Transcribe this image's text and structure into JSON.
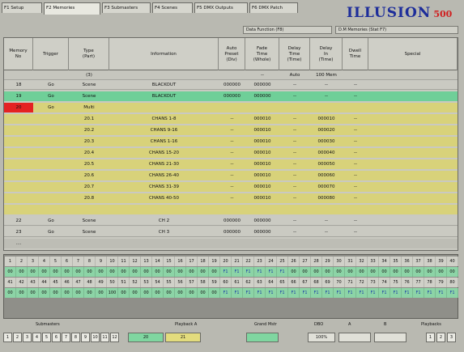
{
  "tabs": [
    "F1 Setup",
    "F2 Memories",
    "F3 Submasters",
    "F4 Scenes",
    "F5 DMX Outputs",
    "F6 DMX Patch"
  ],
  "active_tab": 1,
  "logo": {
    "text": "ILLUSION",
    "number": "500"
  },
  "top_fields": [
    "Data Function (F8)",
    "D.M Memories (Stat F7)"
  ],
  "colors": {
    "green_row": "#6fcf98",
    "yellow_block": "#d8d27a",
    "red_cell": "#e42222",
    "logo_blue": "#1d2d9a",
    "logo_red": "#d02020"
  },
  "columns": [
    "Memory\nNo",
    "Trigger",
    "Type\n(Part)",
    "Information",
    "Auto\nPreset\n(Div)",
    "Fade\nTime\n(Whole)",
    "Delay\nTime\n(Time)",
    "Delay\nIn\n(Time)",
    "Dwell\nTime",
    "Special"
  ],
  "sub_header": [
    "",
    "",
    "(3)",
    "",
    "",
    "--",
    "Auto",
    "100 Mem",
    "",
    ""
  ],
  "rows": [
    {
      "style": "plain",
      "cells": [
        "18",
        "Go",
        "Scene",
        "BLACKOUT",
        "000000",
        "000000",
        "--",
        "--",
        "--",
        ""
      ]
    },
    {
      "style": "green",
      "cells": [
        "19",
        "Go",
        "Scene",
        "BLACKOUT",
        "000000",
        "000000",
        "--",
        "--",
        "--",
        ""
      ]
    },
    {
      "style": "yellow",
      "red_first": true,
      "cells": [
        "20",
        "Go",
        "Multi",
        "",
        "",
        "",
        "",
        "",
        "",
        ""
      ]
    },
    {
      "style": "yellow",
      "cells": [
        "",
        "",
        "20.1",
        "CHANS 1-8",
        "--",
        "000010",
        "--",
        "000010",
        "--",
        ""
      ]
    },
    {
      "style": "yellow",
      "cells": [
        "",
        "",
        "20.2",
        "CHANS 9-16",
        "--",
        "000010",
        "--",
        "000020",
        "--",
        ""
      ]
    },
    {
      "style": "yellow",
      "cells": [
        "",
        "",
        "20.3",
        "CHANS 1-16",
        "--",
        "000010",
        "--",
        "000030",
        "--",
        ""
      ]
    },
    {
      "style": "yellow",
      "cells": [
        "",
        "",
        "20.4",
        "CHANS 15-20",
        "--",
        "000010",
        "--",
        "000040",
        "--",
        ""
      ]
    },
    {
      "style": "yellow",
      "cells": [
        "",
        "",
        "20.5",
        "CHANS 21-30",
        "--",
        "000010",
        "--",
        "000050",
        "--",
        ""
      ]
    },
    {
      "style": "yellow",
      "cells": [
        "",
        "",
        "20.6",
        "CHANS 26-40",
        "--",
        "000010",
        "--",
        "000060",
        "--",
        ""
      ]
    },
    {
      "style": "yellow",
      "cells": [
        "",
        "",
        "20.7",
        "CHANS 31-39",
        "--",
        "000010",
        "--",
        "000070",
        "--",
        ""
      ]
    },
    {
      "style": "yellow",
      "cells": [
        "",
        "",
        "20.8",
        "CHANS 40-50",
        "--",
        "000010",
        "--",
        "000080",
        "--",
        ""
      ]
    },
    {
      "style": "yellow",
      "cells": [
        "",
        "",
        "",
        "",
        "",
        "",
        "",
        "",
        "",
        ""
      ]
    },
    {
      "style": "plain",
      "cells": [
        "22",
        "Go",
        "Scene",
        "CH 2",
        "000000",
        "000000",
        "--",
        "--",
        "--",
        ""
      ]
    },
    {
      "style": "plain",
      "cells": [
        "23",
        "Go",
        "Scene",
        "CH 3",
        "000000",
        "000000",
        "--",
        "--",
        "--",
        ""
      ]
    },
    {
      "style": "footer",
      "cells": [
        "....",
        "",
        "",
        "",
        "",
        "",
        "",
        "",
        "",
        ""
      ]
    }
  ],
  "channel_rows": [
    {
      "style": "lbl",
      "cells": [
        "1",
        "2",
        "3",
        "4",
        "5",
        "6",
        "7",
        "8",
        "9",
        "10",
        "11",
        "12",
        "13",
        "14",
        "15",
        "16",
        "17",
        "18",
        "19",
        "20",
        "21",
        "22",
        "23",
        "24",
        "25",
        "26",
        "27",
        "28",
        "29",
        "30",
        "31",
        "32",
        "33",
        "34",
        "35",
        "36",
        "37",
        "38",
        "39",
        "40"
      ]
    },
    {
      "style": "val",
      "cells": [
        "00",
        "00",
        "00",
        "00",
        "00",
        "00",
        "00",
        "00",
        "00",
        "00",
        "00",
        "00",
        "00",
        "00",
        "00",
        "00",
        "00",
        "00",
        "00",
        "F1",
        "F1",
        "F1",
        "F1",
        "F1",
        "F1",
        "00",
        "00",
        "00",
        "00",
        "00",
        "00",
        "00",
        "00",
        "00",
        "00",
        "00",
        "00",
        "00",
        "00",
        "00"
      ]
    },
    {
      "style": "lbl",
      "cells": [
        "41",
        "42",
        "43",
        "44",
        "45",
        "46",
        "47",
        "48",
        "49",
        "50",
        "51",
        "52",
        "53",
        "54",
        "55",
        "56",
        "57",
        "58",
        "59",
        "60",
        "61",
        "62",
        "63",
        "64",
        "65",
        "66",
        "67",
        "68",
        "69",
        "70",
        "71",
        "72",
        "73",
        "74",
        "75",
        "76",
        "77",
        "78",
        "79",
        "80"
      ]
    },
    {
      "style": "val",
      "cells": [
        "00",
        "00",
        "00",
        "00",
        "00",
        "00",
        "00",
        "00",
        "00",
        "100",
        "00",
        "00",
        "00",
        "00",
        "00",
        "00",
        "00",
        "00",
        "00",
        "F1",
        "F1",
        "F1",
        "F1",
        "F1",
        "F1",
        "F1",
        "F1",
        "F1",
        "F1",
        "F1",
        "F1",
        "F1",
        "F1",
        "F1",
        "F1",
        "F1",
        "F1",
        "F1",
        "F1",
        "F1"
      ]
    }
  ],
  "bottom": {
    "labels": [
      "Submasters",
      "Playback A",
      "Grand Mstr",
      "DBO",
      "A",
      "B",
      "Playbacks"
    ],
    "keys": [
      "1",
      "2",
      "3",
      "4",
      "5",
      "6",
      "7",
      "8",
      "9",
      "10",
      "11",
      "12"
    ],
    "playback_values": [
      "20",
      "21"
    ],
    "grand_value": "",
    "dbo_value": "100%",
    "right_keys": [
      "1",
      "2",
      "3"
    ]
  }
}
